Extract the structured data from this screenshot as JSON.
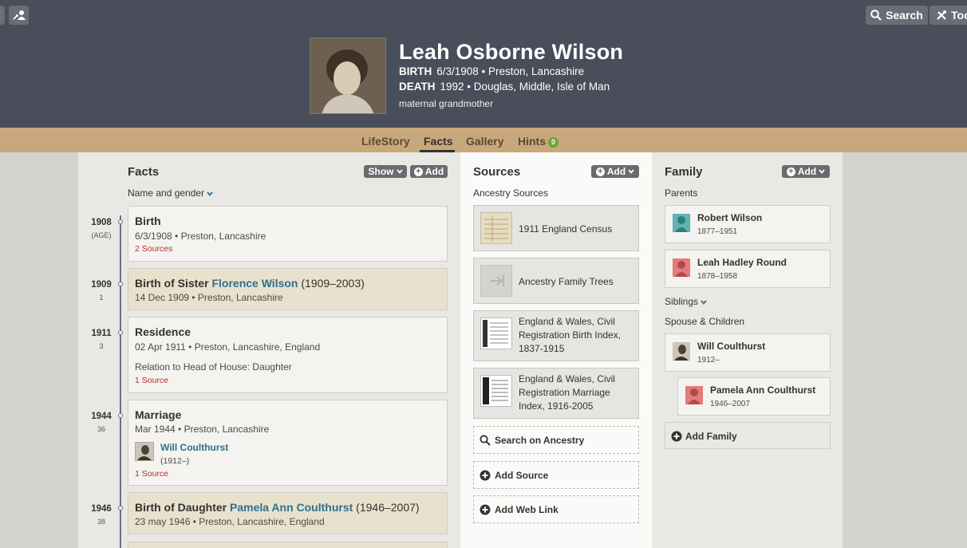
{
  "header": {
    "search_label": "Search",
    "tools_label": "Too",
    "person": {
      "name": "Leah Osborne Wilson",
      "birth_label": "BIRTH",
      "birth_value": "6/3/1908 • Preston, Lancashire",
      "death_label": "DEATH",
      "death_value": "1992 • Douglas, Middle, Isle of Man",
      "relation": "maternal grandmother"
    }
  },
  "tabs": [
    {
      "label": "LifeStory",
      "active": false
    },
    {
      "label": "Facts",
      "active": true
    },
    {
      "label": "Gallery",
      "active": false
    },
    {
      "label": "Hints",
      "active": false,
      "badge": "0"
    }
  ],
  "facts": {
    "title": "Facts",
    "show_label": "Show",
    "add_label": "Add",
    "filter_label": "Name and gender",
    "items": [
      {
        "year": "1908",
        "age": "(AGE)",
        "title": "Birth",
        "line1": "6/3/1908 • Preston, Lancashire",
        "sources": "2 Sources"
      },
      {
        "year": "1909",
        "age": "1",
        "title_prefix": "Birth of Sister ",
        "title_link": "Florence Wilson",
        "title_suffix": " (1909–2003)",
        "line1": "14 Dec 1909 • Preston, Lancashire"
      },
      {
        "year": "1911",
        "age": "3",
        "title": "Residence",
        "line1": "02 Apr 1911 • Preston, Lancashire, England",
        "line2": "Relation to Head of House: Daughter",
        "sources": "1 Source"
      },
      {
        "year": "1944",
        "age": "36",
        "title": "Marriage",
        "line1": "Mar 1944 • Preston, Lancashire",
        "spouse_name": "Will Coulthurst",
        "spouse_dates": "(1912–)",
        "sources": "1 Source"
      },
      {
        "year": "1946",
        "age": "38",
        "title_prefix": "Birth of Daughter ",
        "title_link": "Pamela Ann Coulthurst",
        "title_suffix": " (1946–2007)",
        "line1": "23 may 1946 • Preston, Lancashire, England"
      }
    ]
  },
  "sources": {
    "title": "Sources",
    "add_label": "Add",
    "subtitle": "Ancestry Sources",
    "items": [
      {
        "label": "1911 England Census"
      },
      {
        "label": "Ancestry Family Trees"
      },
      {
        "label": "England & Wales, Civil Registration Birth Index, 1837-1915"
      },
      {
        "label": "England & Wales, Civil Registration Marriage Index, 1916-2005"
      }
    ],
    "search_label": "Search on Ancestry",
    "add_source_label": "Add Source",
    "add_web_link_label": "Add Web Link"
  },
  "family": {
    "title": "Family",
    "add_label": "Add",
    "parents_label": "Parents",
    "parents": [
      {
        "name": "Robert Wilson",
        "dates": "1877–1951",
        "color": "#5fb3b3"
      },
      {
        "name": "Leah Hadley Round",
        "dates": "1878–1958",
        "color": "#e57a7a"
      }
    ],
    "siblings_label": "Siblings",
    "spouse_label": "Spouse & Children",
    "spouse": {
      "name": "Will Coulthurst",
      "dates": "1912–"
    },
    "child": {
      "name": "Pamela Ann Coulthurst",
      "dates": "1946–2007",
      "color": "#e57a7a"
    },
    "add_family_label": "Add Family"
  }
}
